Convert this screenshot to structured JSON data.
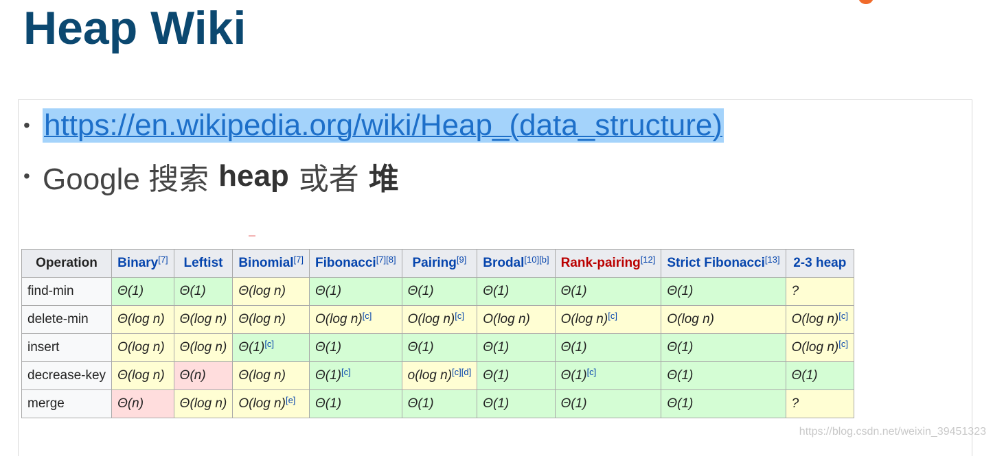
{
  "title": "Heap Wiki",
  "bullets": {
    "link": "https://en.wikipedia.org/wiki/Heap_(data_structure)",
    "search_prefix": "Google 搜索",
    "search_term1": "heap",
    "search_mid": "或者",
    "search_term2": "堆"
  },
  "table": {
    "headers": [
      {
        "label": "Operation",
        "sup": ""
      },
      {
        "label": "Binary",
        "sup": "[7]"
      },
      {
        "label": "Leftist",
        "sup": ""
      },
      {
        "label": "Binomial",
        "sup": "[7]"
      },
      {
        "label": "Fibonacci",
        "sup": "[7][8]"
      },
      {
        "label": "Pairing",
        "sup": "[9]"
      },
      {
        "label": "Brodal",
        "sup": "[10][b]"
      },
      {
        "label": "Rank-pairing",
        "sup": "[12]"
      },
      {
        "label": "Strict Fibonacci",
        "sup": "[13]"
      },
      {
        "label": "2-3 heap",
        "sup": ""
      }
    ],
    "rows": [
      {
        "label": "find-min",
        "cells": [
          {
            "text": "Θ(1)",
            "sup": ""
          },
          {
            "text": "Θ(1)",
            "sup": ""
          },
          {
            "text": "Θ(log n)",
            "sup": ""
          },
          {
            "text": "Θ(1)",
            "sup": ""
          },
          {
            "text": "Θ(1)",
            "sup": ""
          },
          {
            "text": "Θ(1)",
            "sup": ""
          },
          {
            "text": "Θ(1)",
            "sup": ""
          },
          {
            "text": "Θ(1)",
            "sup": ""
          },
          {
            "text": "?",
            "sup": ""
          }
        ]
      },
      {
        "label": "delete-min",
        "cells": [
          {
            "text": "Θ(log n)",
            "sup": ""
          },
          {
            "text": "Θ(log n)",
            "sup": ""
          },
          {
            "text": "Θ(log n)",
            "sup": ""
          },
          {
            "text": "O(log n)",
            "sup": "[c]"
          },
          {
            "text": "O(log n)",
            "sup": "[c]"
          },
          {
            "text": "O(log n)",
            "sup": ""
          },
          {
            "text": "O(log n)",
            "sup": "[c]"
          },
          {
            "text": "O(log n)",
            "sup": ""
          },
          {
            "text": "O(log n)",
            "sup": "[c]"
          }
        ]
      },
      {
        "label": "insert",
        "cells": [
          {
            "text": "O(log n)",
            "sup": ""
          },
          {
            "text": "Θ(log n)",
            "sup": ""
          },
          {
            "text": "Θ(1)",
            "sup": "[c]"
          },
          {
            "text": "Θ(1)",
            "sup": ""
          },
          {
            "text": "Θ(1)",
            "sup": ""
          },
          {
            "text": "Θ(1)",
            "sup": ""
          },
          {
            "text": "Θ(1)",
            "sup": ""
          },
          {
            "text": "Θ(1)",
            "sup": ""
          },
          {
            "text": "O(log n)",
            "sup": "[c]"
          }
        ]
      },
      {
        "label": "decrease-key",
        "cells": [
          {
            "text": "Θ(log n)",
            "sup": ""
          },
          {
            "text": "Θ(n)",
            "sup": ""
          },
          {
            "text": "Θ(log n)",
            "sup": ""
          },
          {
            "text": "Θ(1)",
            "sup": "[c]"
          },
          {
            "text": "o(log n)",
            "sup": "[c][d]"
          },
          {
            "text": "Θ(1)",
            "sup": ""
          },
          {
            "text": "Θ(1)",
            "sup": "[c]"
          },
          {
            "text": "Θ(1)",
            "sup": ""
          },
          {
            "text": "Θ(1)",
            "sup": ""
          }
        ]
      },
      {
        "label": "merge",
        "cells": [
          {
            "text": "Θ(n)",
            "sup": ""
          },
          {
            "text": "Θ(log n)",
            "sup": ""
          },
          {
            "text": "O(log n)",
            "sup": "[e]"
          },
          {
            "text": "Θ(1)",
            "sup": ""
          },
          {
            "text": "Θ(1)",
            "sup": ""
          },
          {
            "text": "Θ(1)",
            "sup": ""
          },
          {
            "text": "Θ(1)",
            "sup": ""
          },
          {
            "text": "Θ(1)",
            "sup": ""
          },
          {
            "text": "?",
            "sup": ""
          }
        ]
      }
    ]
  },
  "watermark": "https://blog.csdn.net/weixin_39451323",
  "colors": {
    "title": "#0b4870",
    "link_highlight": "#a4d3fb",
    "link_text": "#1d6fc9",
    "cell_green": "#d4fdd4",
    "cell_yellow": "#fffed3",
    "cell_red": "#ffdddd",
    "header_bg": "#eaecf0",
    "header_link": "#0645ad",
    "header_redlink": "#ba0000"
  }
}
